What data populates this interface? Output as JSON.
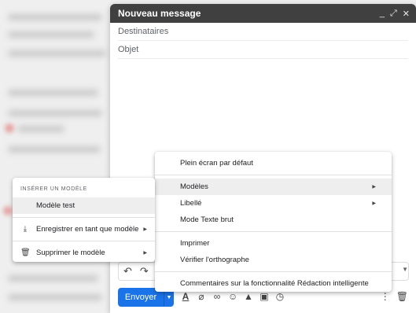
{
  "compose": {
    "title": "Nouveau message",
    "minimize_icon": "_",
    "expand_icon": "⤢",
    "close_icon": "✕",
    "recipients_placeholder": "Destinataires",
    "subject_placeholder": "Objet",
    "send_label": "Envoyer"
  },
  "main_menu": {
    "items": [
      {
        "label": "Plein écran par défaut"
      },
      {
        "label": "Modèles"
      },
      {
        "label": "Libellé"
      },
      {
        "label": "Mode Texte brut"
      },
      {
        "label": "Imprimer"
      },
      {
        "label": "Vérifier l'orthographe"
      },
      {
        "label": "Commentaires sur la fonctionnalité Rédaction intelligente"
      }
    ]
  },
  "templates_menu": {
    "section_title": "INSÉRER UN MODÈLE",
    "items": [
      {
        "label": "Modèle test"
      },
      {
        "label": "Enregistrer en tant que modèle"
      },
      {
        "label": "Supprimer le modèle"
      }
    ]
  },
  "colors": {
    "header_bg": "#404040",
    "send_button": "#1a73e8",
    "menu_highlight": "#eeeeee"
  }
}
